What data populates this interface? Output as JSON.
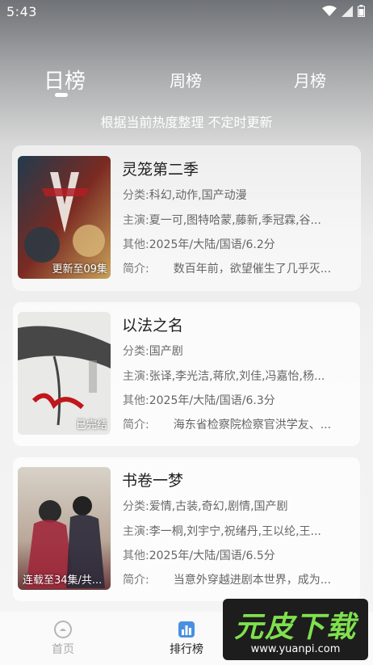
{
  "status_bar": {
    "time": "5:43"
  },
  "tabs": [
    {
      "label": "日榜",
      "active": true
    },
    {
      "label": "周榜",
      "active": false
    },
    {
      "label": "月榜",
      "active": false
    }
  ],
  "subtitle": "根据当前热度整理 不定时更新",
  "field_labels": {
    "type": "分类:",
    "cast": "主演:",
    "other": "其他:",
    "intro": "简介:"
  },
  "items": [
    {
      "title": "灵笼第二季",
      "type": "科幻,动作,国产动漫",
      "cast": "夏一可,图特哈蒙,藤新,季冠霖,谷...",
      "other": "2025年/大陆/国语/6.2分",
      "intro": "数百年前，欲望催生了几乎灭...",
      "badge": "更新至09集"
    },
    {
      "title": "以法之名",
      "type": "国产剧",
      "cast": "张译,李光洁,蒋欣,刘佳,冯嘉怡,杨...",
      "other": "2025年/大陆/国语/6.3分",
      "intro": "海东省检察院检察官洪学友、...",
      "badge": "已完结"
    },
    {
      "title": "书卷一梦",
      "type": "爱情,古装,奇幻,剧情,国产剧",
      "cast": "李一桐,刘宇宁,祝绪丹,王以纶,王...",
      "other": "2025年/大陆/国语/6.5分",
      "intro": "当意外穿越进剧本世界，成为...",
      "badge": "连载至34集/共..."
    }
  ],
  "bottom_nav": {
    "home": "首页",
    "rank": "排行榜"
  },
  "watermark": {
    "brand": "元皮下载",
    "url": "www.yuanpi.com"
  }
}
